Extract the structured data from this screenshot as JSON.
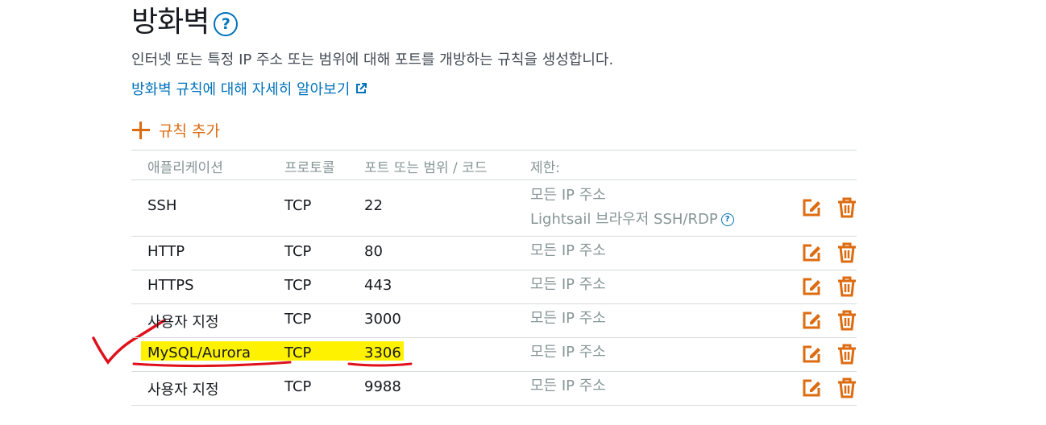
{
  "header": {
    "title": "방화벽",
    "description": "인터넷 또는 특정 IP 주소 또는 범위에 대해 포트를 개방하는 규칙을 생성합니다.",
    "learn_more": "방화벽 규칙에 대해 자세히 알아보기",
    "help_glyph": "?"
  },
  "add_rule": {
    "label": "규칙 추가"
  },
  "table": {
    "columns": [
      "애플리케이션",
      "프로토콜",
      "포트 또는 범위 / 코드",
      "제한:"
    ],
    "rows": [
      {
        "application": "SSH",
        "protocol": "TCP",
        "port": "22",
        "restriction": "모든 IP 주소",
        "restriction_extra": "Lightsail 브라우저 SSH/RDP"
      },
      {
        "application": "HTTP",
        "protocol": "TCP",
        "port": "80",
        "restriction": "모든 IP 주소"
      },
      {
        "application": "HTTPS",
        "protocol": "TCP",
        "port": "443",
        "restriction": "모든 IP 주소"
      },
      {
        "application": "사용자 지정",
        "protocol": "TCP",
        "port": "3000",
        "restriction": "모든 IP 주소"
      },
      {
        "application": "MySQL/Aurora",
        "protocol": "TCP",
        "port": "3306",
        "restriction": "모든 IP 주소"
      },
      {
        "application": "사용자 지정",
        "protocol": "TCP",
        "port": "9988",
        "restriction": "모든 IP 주소"
      }
    ]
  },
  "colors": {
    "accent_orange": "#dd6b10",
    "link_blue": "#0073bb",
    "highlight_yellow": "#fff200",
    "annotation_red": "#e0101a"
  },
  "icons": [
    "help-icon",
    "external-link-icon",
    "plus-icon",
    "edit-icon",
    "trash-icon"
  ]
}
